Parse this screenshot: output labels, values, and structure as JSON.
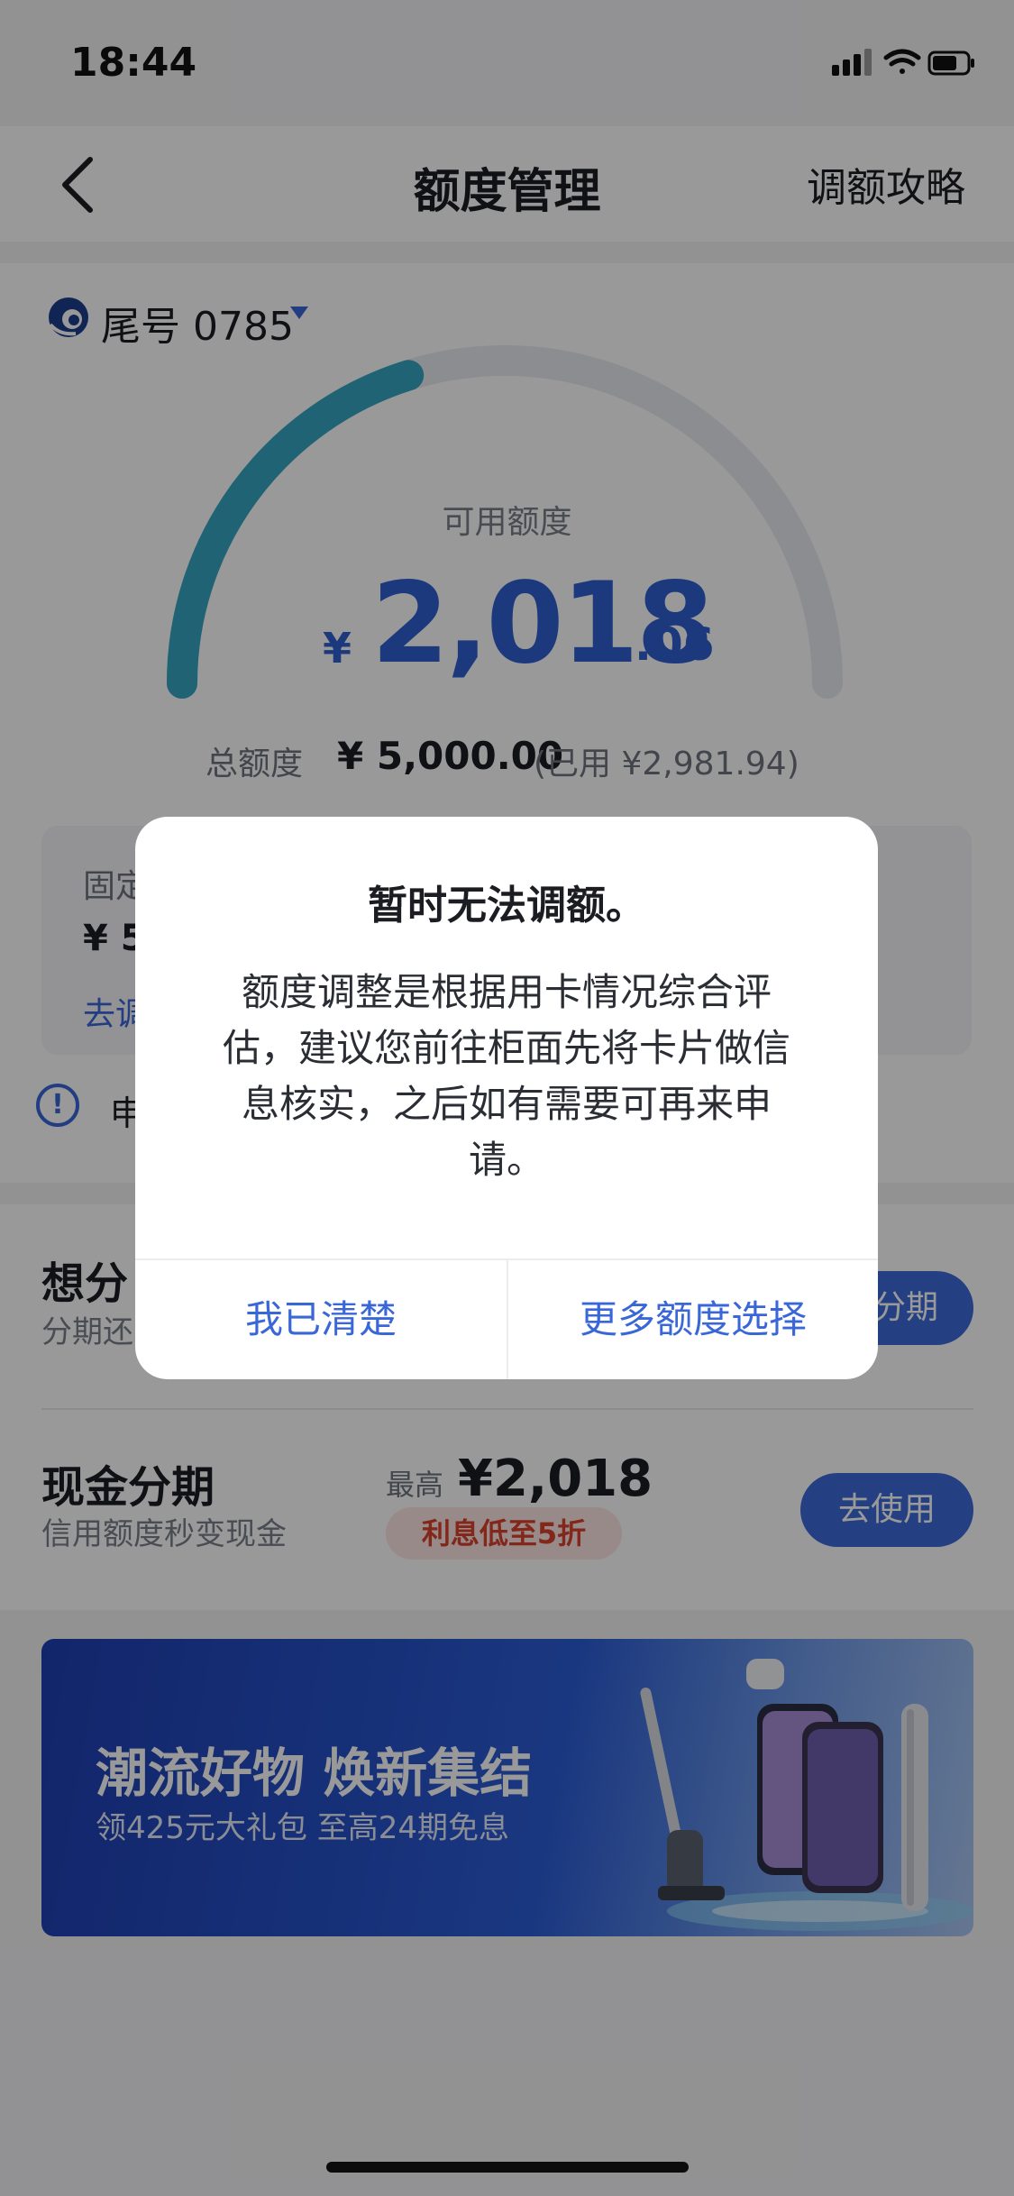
{
  "status": {
    "time": "18:44"
  },
  "nav": {
    "title": "额度管理",
    "right_link": "调额攻略"
  },
  "card": {
    "tail": "尾号 0785"
  },
  "credit": {
    "available_label": "可用额度",
    "currency": "¥",
    "available_int": "2,018",
    "available_dec": ".06",
    "available_fraction": 0.4036,
    "total_label": "总额度",
    "total_value": "¥ 5,000.00",
    "used_text": "(已用 ¥2,981.94)"
  },
  "fixed": {
    "label": "固定",
    "value": "¥ 5",
    "link": "去调"
  },
  "notice": {
    "icon": "info-icon",
    "text": "申"
  },
  "installment": {
    "title": "想分",
    "subtitle": "分期还",
    "button": "分期"
  },
  "cash": {
    "title": "现金分期",
    "subtitle": "信用额度秒变现金",
    "max_label": "最高",
    "max_value": "¥2,018",
    "badge": "利息低至5折",
    "button": "去使用"
  },
  "banner": {
    "title": "潮流好物 焕新集结",
    "subtitle": "领425元大礼包 至高24期免息"
  },
  "dialog": {
    "title": "暂时无法调额。",
    "body": "额度调整是根据用卡情况综合评估，建议您前往柜面先将卡片做信息核实，之后如有需要可再来申请。",
    "btn_left": "我已清楚",
    "btn_right": "更多额度选择"
  },
  "colors": {
    "accent": "#3a67d8",
    "gauge_fill": "#35a6c4",
    "gauge_track": "#e9ecf1",
    "badge_text": "#d9412c"
  }
}
